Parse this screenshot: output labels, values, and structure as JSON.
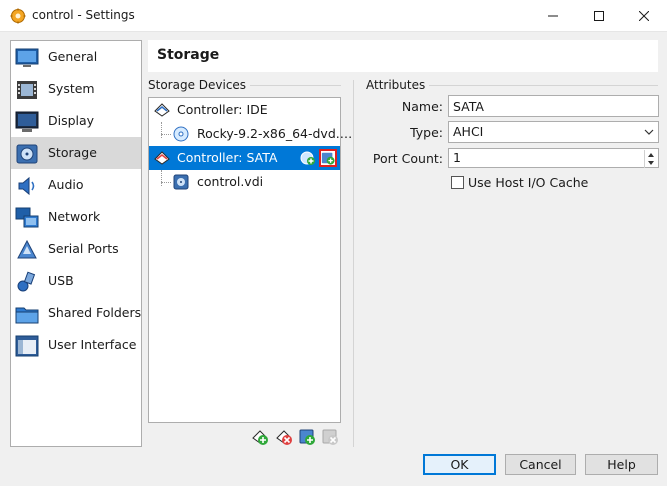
{
  "window": {
    "title": "control - Settings"
  },
  "sidebar": {
    "items": [
      {
        "label": "General",
        "icon": "general-icon"
      },
      {
        "label": "System",
        "icon": "system-icon"
      },
      {
        "label": "Display",
        "icon": "display-icon"
      },
      {
        "label": "Storage",
        "icon": "storage-icon",
        "selected": true
      },
      {
        "label": "Audio",
        "icon": "audio-icon"
      },
      {
        "label": "Network",
        "icon": "network-icon"
      },
      {
        "label": "Serial Ports",
        "icon": "serial-ports-icon"
      },
      {
        "label": "USB",
        "icon": "usb-icon"
      },
      {
        "label": "Shared Folders",
        "icon": "shared-folders-icon"
      },
      {
        "label": "User Interface",
        "icon": "user-interface-icon"
      }
    ]
  },
  "page": {
    "title": "Storage"
  },
  "storage_devices": {
    "label": "Storage Devices",
    "tree": [
      {
        "label": "Controller: IDE",
        "type": "controller"
      },
      {
        "label": "Rocky-9.2-x86_64-dvd.…",
        "type": "optical"
      },
      {
        "label": "Controller: SATA",
        "type": "controller",
        "selected": true
      },
      {
        "label": "control.vdi",
        "type": "disk"
      }
    ]
  },
  "attributes": {
    "label": "Attributes",
    "name_label": "Name:",
    "name_value": "SATA",
    "type_label": "Type:",
    "type_value": "AHCI",
    "port_count_label": "Port Count:",
    "port_count_value": "1",
    "host_io_cache_label": "Use Host I/O Cache",
    "host_io_cache_checked": false
  },
  "buttons": {
    "ok": "OK",
    "cancel": "Cancel",
    "help": "Help"
  },
  "colors": {
    "selection": "#0078d7",
    "highlight_border": "#e02020"
  }
}
